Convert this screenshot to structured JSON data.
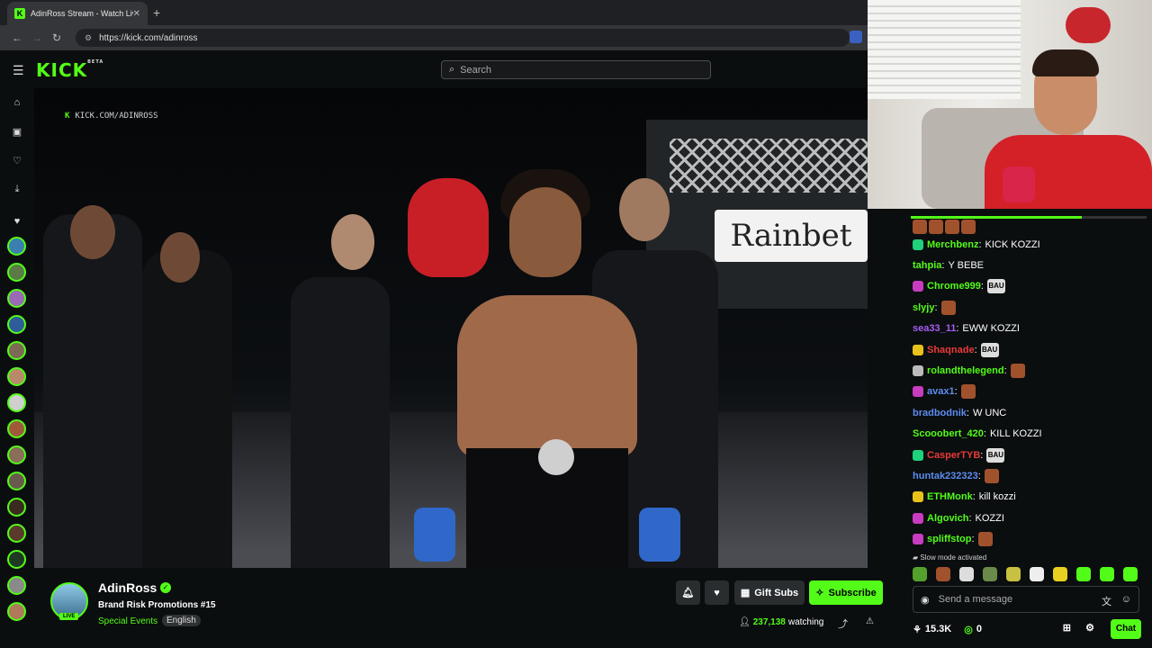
{
  "browser": {
    "tab_title": "AdinRoss Stream - Watch Live c",
    "url": "https://kick.com/adinross"
  },
  "header": {
    "logo": "KICK",
    "logo_tag": "BETA",
    "search_placeholder": "Search"
  },
  "video": {
    "watermark": "KICK.COM/ADINROSS",
    "banner_text": "Rainbet"
  },
  "chat": {
    "messages": [
      {
        "user": "Merchbenz",
        "color": "#53fc18",
        "text": "KICK KOZZI",
        "badge": "#1fd17b"
      },
      {
        "user": "tahpia",
        "color": "#53fc18",
        "text": "Y BEBE",
        "badge": ""
      },
      {
        "user": "Chrome999",
        "color": "#53fc18",
        "text": "",
        "badge": "#c83cc0",
        "emote": "BAU"
      },
      {
        "user": "slyjy",
        "color": "#53fc18",
        "text": "",
        "badge": "",
        "emote": "img"
      },
      {
        "user": "sea33_11",
        "color": "#a45cf0",
        "text": "EWW KOZZI",
        "badge": ""
      },
      {
        "user": "Shaqnade",
        "color": "#e83a3a",
        "text": "",
        "badge": "#e8c21a",
        "emote": "BAU"
      },
      {
        "user": "rolandthelegend",
        "color": "#53fc18",
        "text": "",
        "badge": "#bbbbbb",
        "emote": "img"
      },
      {
        "user": "avax1",
        "color": "#5c8cf0",
        "text": "",
        "badge": "#c83cc0",
        "emote": "img"
      },
      {
        "user": "bradbodnik",
        "color": "#5c8cf0",
        "text": "W UNC",
        "badge": ""
      },
      {
        "user": "Scooobert_420",
        "color": "#53fc18",
        "text": "KILL KOZZI",
        "badge": ""
      },
      {
        "user": "CasperTYB",
        "color": "#e83a3a",
        "text": "",
        "badge": "#1fd17b",
        "emote": "BAU"
      },
      {
        "user": "huntak232323",
        "color": "#5c8cf0",
        "text": "",
        "badge": "",
        "emote": "img"
      },
      {
        "user": "ETHMonk",
        "color": "#53fc18",
        "text": "kill kozzi",
        "badge": "#e8c21a"
      },
      {
        "user": "Algovich",
        "color": "#53fc18",
        "text": "KOZZI",
        "badge": "#c83cc0"
      },
      {
        "user": "spliffstop",
        "color": "#53fc18",
        "text": "",
        "badge": "#c83cc0",
        "emote": "img"
      }
    ],
    "slow_mode": "Slow mode activated",
    "input_placeholder": "Send a message",
    "followers": "15.3K",
    "kicks": "0",
    "chat_button": "Chat"
  },
  "channel": {
    "name": "AdinRoss",
    "live_badge": "LIVE",
    "stream_title": "Brand Risk Promotions #15",
    "category": "Special Events",
    "language": "English",
    "gift_subs": "Gift Subs",
    "subscribe": "Subscribe",
    "viewers": "237,138",
    "watching_label": "watching"
  }
}
